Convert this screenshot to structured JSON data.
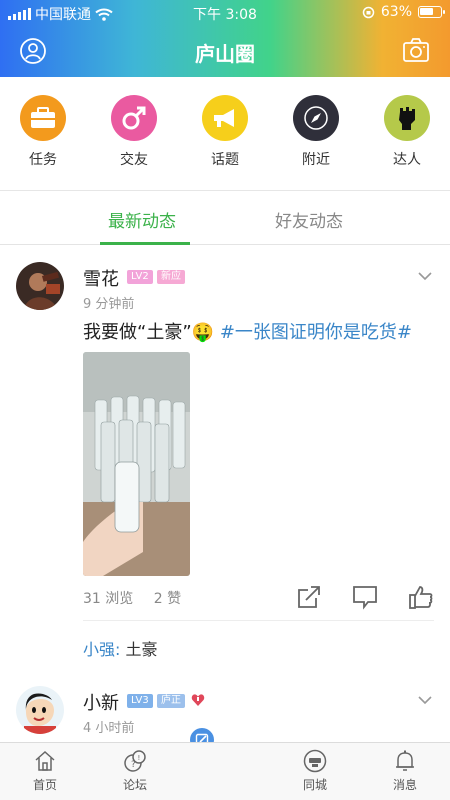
{
  "status_bar": {
    "carrier": "中国联通",
    "time": "下午 3:08",
    "battery": "63%",
    "battery_level": 0.63
  },
  "header": {
    "title": "庐山圈"
  },
  "shortcuts": [
    {
      "label": "任务",
      "color": "#f39a1d",
      "icon": "briefcase-icon"
    },
    {
      "label": "交友",
      "color": "#ea5aa0",
      "icon": "male-symbol-icon"
    },
    {
      "label": "话题",
      "color": "#f6cf1b",
      "icon": "megaphone-icon"
    },
    {
      "label": "附近",
      "color": "#2f2f3a",
      "icon": "compass-icon"
    },
    {
      "label": "达人",
      "color": "#b5c94a",
      "icon": "fist-icon"
    }
  ],
  "tabs": {
    "active": "最新动态",
    "inactive": "好友动态"
  },
  "posts": [
    {
      "name": "雪花",
      "level": "LV2",
      "tag": "新应",
      "time": "9 分钟前",
      "text": "我要做“土豪”",
      "emoji": "🤑",
      "topic": "#一张图证明你是吃货#",
      "views": "31 浏览",
      "likes": "2 赞",
      "comment_user": "小强:",
      "comment_text": "土豪"
    },
    {
      "name": "小新",
      "level": "LV3",
      "tag": "庐正",
      "time": "4 小时前"
    }
  ],
  "bottom_nav": [
    {
      "label": "首页",
      "icon": "home-icon"
    },
    {
      "label": "论坛",
      "icon": "forum-icon"
    },
    {
      "label": "同城",
      "icon": "city-icon"
    },
    {
      "label": "消息",
      "icon": "bell-icon"
    }
  ],
  "colors": {
    "accent": "#3bb24a",
    "link": "#3a86c8"
  }
}
